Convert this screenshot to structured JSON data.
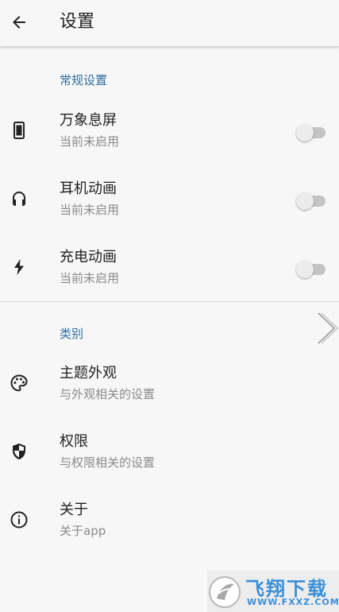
{
  "appbar": {
    "title": "设置",
    "back_icon": "arrow-back-icon"
  },
  "sections": {
    "general": {
      "header": "常规设置"
    },
    "category": {
      "header": "类别"
    }
  },
  "general_items": [
    {
      "title": "万象息屏",
      "summary": "当前未启用",
      "icon": "phone-screen-icon",
      "enabled": false
    },
    {
      "title": "耳机动画",
      "summary": "当前未启用",
      "icon": "headphones-icon",
      "enabled": false
    },
    {
      "title": "充电动画",
      "summary": "当前未启用",
      "icon": "lightning-bolt-icon",
      "enabled": false
    }
  ],
  "category_items": [
    {
      "title": "主题外观",
      "summary": "与外观相关的设置",
      "icon": "palette-icon"
    },
    {
      "title": "权限",
      "summary": "与权限相关的设置",
      "icon": "shield-icon"
    },
    {
      "title": "关于",
      "summary": "关于app",
      "icon": "info-icon"
    }
  ],
  "watermark": {
    "text": "飞翔下载",
    "url": "WWW.FXXZ.COM"
  },
  "colors": {
    "background": "#f7f7f7",
    "section_header": "#2f6e9e",
    "title_text": "#222222",
    "summary_text": "#8a8a8a",
    "switch_track_off": "#c4c4c4",
    "switch_thumb_off": "#ececec",
    "watermark_blue": "#3a8fd8"
  }
}
